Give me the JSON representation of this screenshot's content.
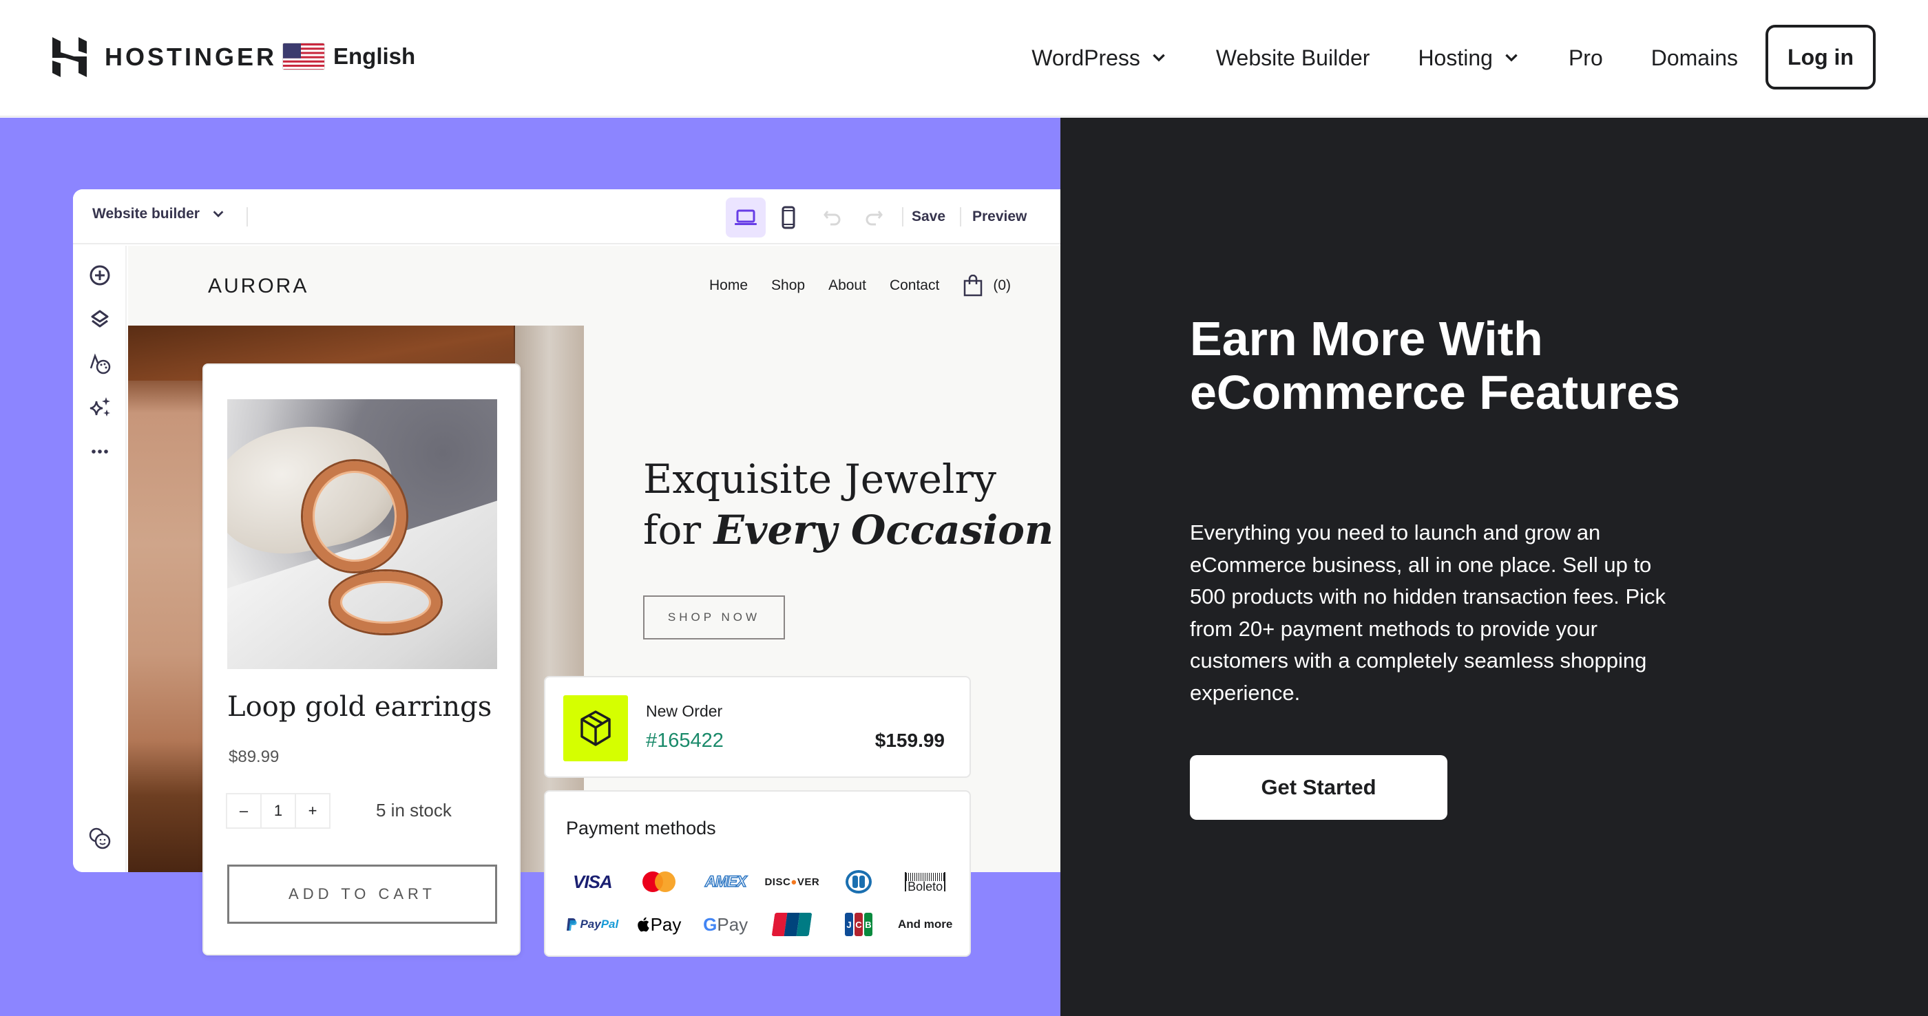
{
  "header": {
    "brand": "HOSTINGER",
    "language": "English",
    "nav": [
      {
        "label": "WordPress",
        "has_dropdown": true
      },
      {
        "label": "Website Builder",
        "has_dropdown": false
      },
      {
        "label": "Hosting",
        "has_dropdown": true
      },
      {
        "label": "Pro",
        "has_dropdown": false
      },
      {
        "label": "Domains",
        "has_dropdown": false
      }
    ],
    "login_label": "Log in"
  },
  "builder": {
    "mode_select": "Website builder",
    "active_device": "desktop",
    "save_label": "Save",
    "preview_label": "Preview",
    "tools": [
      "add-element",
      "layers",
      "styles",
      "ai-tools",
      "more"
    ],
    "accent_color": "#673de6"
  },
  "site": {
    "logo": "AURORA",
    "nav": [
      "Home",
      "Shop",
      "About",
      "Contact"
    ],
    "cart_count": "(0)",
    "hero_line1": "Exquisite Jewelry",
    "hero_line2_prefix": "for ",
    "hero_line2_emphasis": "Every Occasion",
    "shop_button": "SHOP NOW"
  },
  "product": {
    "name": "Loop gold earrings",
    "price": "$89.99",
    "qty_minus": "–",
    "quantity": "1",
    "qty_plus": "+",
    "stock": "5 in stock",
    "add_to_cart": "ADD TO CART"
  },
  "order": {
    "label": "New Order",
    "id": "#165422",
    "total": "$159.99",
    "badge_color": "#d5ff00"
  },
  "payments": {
    "title": "Payment methods",
    "methods": [
      "VISA",
      "Mastercard",
      "AMEX",
      "DISCOVER",
      "Diners Club",
      "Boleto",
      "PayPal",
      "Apple Pay",
      "G Pay",
      "UnionPay",
      "JCB",
      "And more"
    ],
    "visa": "VISA",
    "amex": "AMEX",
    "discover_a": "DISC",
    "discover_o": "●",
    "discover_b": "VER",
    "boleto": "Boleto",
    "paypal_a": "Pay",
    "paypal_b": "Pal",
    "apple": " Pay",
    "gpay_g": "G",
    "gpay": " Pay",
    "jcb": [
      "J",
      "C",
      "B"
    ],
    "more": "And more"
  },
  "promo": {
    "headline": "Earn More With eCommerce Features",
    "description": "Everything you need to launch and grow an eCommerce business, all in one place. Sell up to 500 products with no hidden transaction fees. Pick from 20+ payment methods to provide your customers with a completely seamless shopping experience.",
    "cta": "Get Started"
  },
  "colors": {
    "hero_bg": "#8c85ff",
    "dark_bg": "#1f2023"
  }
}
